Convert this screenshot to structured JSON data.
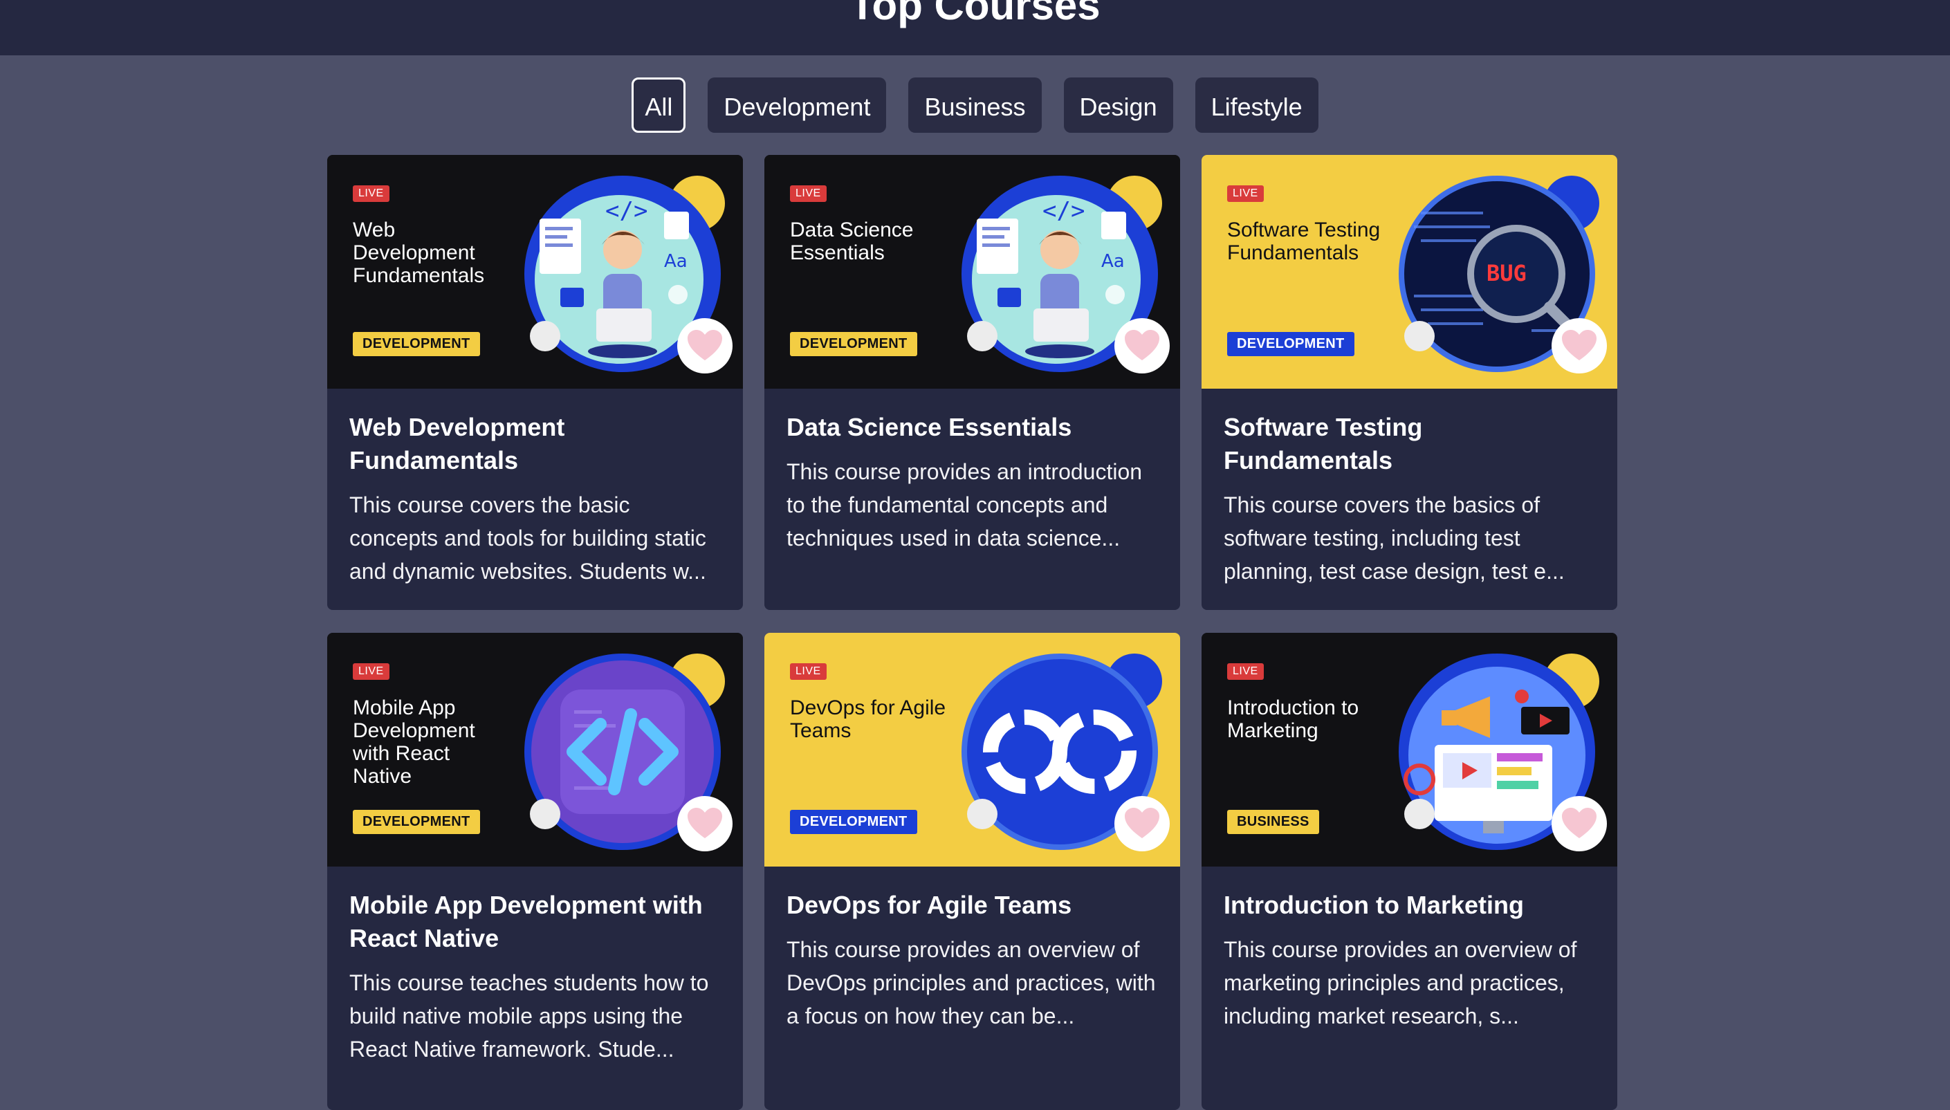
{
  "header": {
    "title": "Top Courses"
  },
  "filters": [
    "All",
    "Development",
    "Business",
    "Design",
    "Lifestyle"
  ],
  "live_label": "LIVE",
  "courses": [
    {
      "thumb_title": "Web Development Fundamentals",
      "category": "DEVELOPMENT",
      "title": "Web Development Fundamentals",
      "description": "This course covers the basic concepts and tools for building static and dynamic websites. Students w...",
      "art": "developer-illustration"
    },
    {
      "thumb_title": "Data Science Essentials",
      "category": "DEVELOPMENT",
      "title": "Data Science Essentials",
      "description": "This course provides an introduction to the fundamental concepts and techniques used in data science...",
      "art": "developer-illustration"
    },
    {
      "thumb_title": "Software Testing Fundamentals",
      "category": "DEVELOPMENT",
      "title": "Software Testing Fundamentals",
      "description": "This course covers the basics of software testing, including test planning, test case design, test e...",
      "art": "magnifier-bug-illustration",
      "art_text": "BUG"
    },
    {
      "thumb_title": "Mobile App Development with React Native",
      "category": "DEVELOPMENT",
      "title": "Mobile App Development with React Native",
      "description": "This course teaches students how to build native mobile apps using the React Native framework. Stude...",
      "art": "code-brackets-illustration"
    },
    {
      "thumb_title": "DevOps for Agile Teams",
      "category": "DEVELOPMENT",
      "title": "DevOps for Agile Teams",
      "description": "This course provides an overview of DevOps principles and practices, with a focus on how they can be...",
      "art": "infinity-loop-illustration"
    },
    {
      "thumb_title": "Introduction to Marketing",
      "category": "BUSINESS",
      "title": "Introduction to Marketing",
      "description": "This course provides an overview of marketing principles and practices, including market research, s...",
      "art": "megaphone-illustration"
    }
  ],
  "colors": {
    "page_bg": "#4d5069",
    "header_bg": "#252841",
    "card_bg": "#252841",
    "yellow": "#f3cd43",
    "blue": "#1c3fd6",
    "live_red": "#d93b3b",
    "heart_pink": "#f6c6d2"
  }
}
